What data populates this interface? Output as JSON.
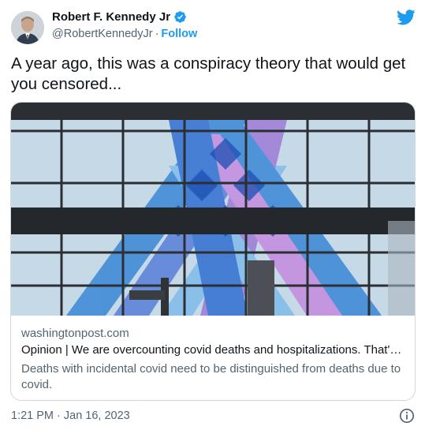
{
  "author": {
    "display_name": "Robert F. Kennedy Jr",
    "handle": "@RobertKennedyJr",
    "separator": "·",
    "follow_label": "Follow"
  },
  "icons": {
    "verified": "verified-badge-icon",
    "brand": "twitter-bird-icon",
    "info": "info-icon"
  },
  "colors": {
    "accent": "#1d9bf0",
    "text_primary": "#0f1419",
    "text_secondary": "#536471",
    "card_border": "#cfd9de"
  },
  "tweet": {
    "text": "A year ago, this was a conspiracy theory that would get you censored..."
  },
  "card": {
    "domain": "washingtonpost.com",
    "title": "Opinion | We are overcounting covid deaths and hospitalizations. That'…",
    "description": "Deaths with incidental covid need to be distinguished from deaths due to covid."
  },
  "footer": {
    "timestamp": "1:21 PM · Jan 16, 2023"
  }
}
